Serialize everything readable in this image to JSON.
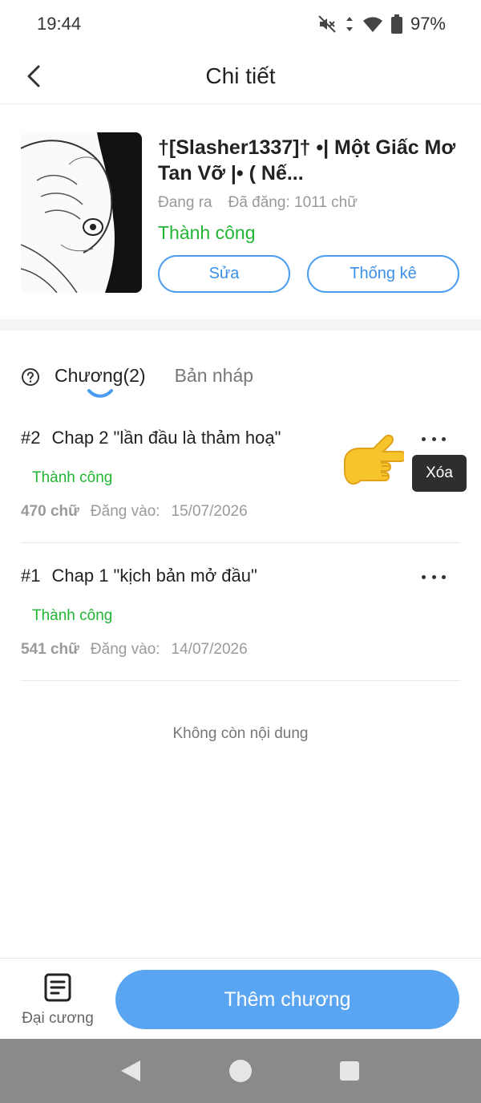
{
  "status_bar": {
    "time": "19:44",
    "battery": "97%"
  },
  "header": {
    "title": "Chi tiết"
  },
  "story": {
    "title": "†[Slasher1337]† •| Một Giấc Mơ Tan Vỡ |• ( Nế...",
    "status_label": "Đang ra",
    "word_count": "Đã đăng: 1011 chữ",
    "publish_status": "Thành công",
    "edit_label": "Sửa",
    "stats_label": "Thống kê"
  },
  "tabs": {
    "chapters": "Chương(2)",
    "drafts": "Bản nháp"
  },
  "chapters": [
    {
      "number": "#2",
      "title": "Chap 2 \"lần đầu là thảm hoạ\"",
      "status": "Thành công",
      "words": "470 chữ",
      "posted_label": "Đăng vào:",
      "date": "15/07/2026"
    },
    {
      "number": "#1",
      "title": "Chap 1 \"kịch bản mở đầu\"",
      "status": "Thành công",
      "words": "541 chữ",
      "posted_label": "Đăng vào:",
      "date": "14/07/2026"
    }
  ],
  "tooltip": {
    "delete": "Xóa"
  },
  "footer_note": "Không còn nội dung",
  "bottom": {
    "outline_label": "Đại cương",
    "add_chapter": "Thêm chương"
  },
  "colors": {
    "accent": "#5aa5f2",
    "success": "#22b534",
    "tooltip_bg": "#2e2e2e"
  }
}
